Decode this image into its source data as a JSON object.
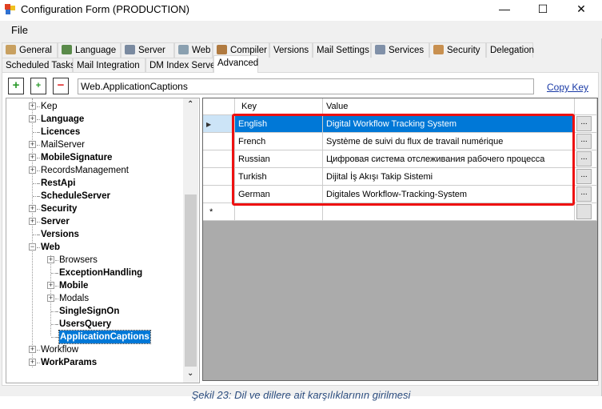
{
  "window": {
    "title": "Configuration Form (PRODUCTION)",
    "minimize": "—",
    "maximize": "☐",
    "close": "✕"
  },
  "menu": {
    "file": "File"
  },
  "tabs_row1": [
    {
      "label": "General",
      "icon": "gear-icon",
      "color": "#c8a060"
    },
    {
      "label": "Language",
      "icon": "globe-icon",
      "color": "#5a8a4a"
    },
    {
      "label": "Server",
      "icon": "server-icon",
      "color": "#7a8aa0"
    },
    {
      "label": "Web",
      "icon": "web-page-icon",
      "color": "#8aa0b0"
    },
    {
      "label": "Compiler",
      "icon": "compiler-icon",
      "color": "#b07a40"
    },
    {
      "label": "Versions"
    },
    {
      "label": "Mail Settings"
    },
    {
      "label": "Services",
      "icon": "cog-icon",
      "color": "#8090a8"
    },
    {
      "label": "Security",
      "icon": "keys-icon",
      "color": "#c89050"
    },
    {
      "label": "Delegation"
    }
  ],
  "tabs_row2": [
    {
      "label": "Scheduled Tasks"
    },
    {
      "label": "Mail Integration"
    },
    {
      "label": "DM Index Server"
    },
    {
      "label": "Advanced"
    }
  ],
  "toolbar": {
    "add_root": "+",
    "add_child": "+",
    "remove": "−",
    "key_value": "Web.ApplicationCaptions",
    "copy_key": "Copy Key"
  },
  "tree": [
    {
      "label": "Kep",
      "level": 1,
      "expandable": true,
      "bold": false
    },
    {
      "label": "Language",
      "level": 1,
      "expandable": true,
      "bold": true
    },
    {
      "label": "Licences",
      "level": 1,
      "expandable": false,
      "bold": true
    },
    {
      "label": "MailServer",
      "level": 1,
      "expandable": true,
      "bold": false
    },
    {
      "label": "MobileSignature",
      "level": 1,
      "expandable": true,
      "bold": true
    },
    {
      "label": "RecordsManagement",
      "level": 1,
      "expandable": true,
      "bold": false
    },
    {
      "label": "RestApi",
      "level": 1,
      "expandable": false,
      "bold": true
    },
    {
      "label": "ScheduleServer",
      "level": 1,
      "expandable": false,
      "bold": true
    },
    {
      "label": "Security",
      "level": 1,
      "expandable": true,
      "bold": true
    },
    {
      "label": "Server",
      "level": 1,
      "expandable": true,
      "bold": true
    },
    {
      "label": "Versions",
      "level": 1,
      "expandable": false,
      "bold": true
    },
    {
      "label": "Web",
      "level": 1,
      "expandable": true,
      "expanded": true,
      "bold": true
    },
    {
      "label": "Browsers",
      "level": 2,
      "expandable": true,
      "bold": false
    },
    {
      "label": "ExceptionHandling",
      "level": 2,
      "expandable": false,
      "bold": true
    },
    {
      "label": "Mobile",
      "level": 2,
      "expandable": true,
      "bold": true
    },
    {
      "label": "Modals",
      "level": 2,
      "expandable": true,
      "bold": false
    },
    {
      "label": "SingleSignOn",
      "level": 2,
      "expandable": false,
      "bold": true
    },
    {
      "label": "UsersQuery",
      "level": 2,
      "expandable": false,
      "bold": true
    },
    {
      "label": "ApplicationCaptions",
      "level": 2,
      "expandable": false,
      "bold": true,
      "selected": true
    },
    {
      "label": "Workflow",
      "level": 1,
      "expandable": true,
      "bold": false
    },
    {
      "label": "WorkParams",
      "level": 1,
      "expandable": true,
      "bold": true
    }
  ],
  "grid": {
    "columns": [
      "Key",
      "Value"
    ],
    "rows": [
      {
        "key": "English",
        "value": "Digital Workflow Tracking System",
        "selected": true
      },
      {
        "key": "French",
        "value": "Système de suivi du flux de travail numérique"
      },
      {
        "key": "Russian",
        "value": "Цифровая система отслеживания рабочего процесса"
      },
      {
        "key": "Turkish",
        "value": "Dijital İş Akışı Takip Sistemi"
      },
      {
        "key": "German",
        "value": "Digitales Workflow-Tracking-System"
      }
    ],
    "ellipsis": "...",
    "current_row_marker": "▶",
    "new_row_marker": "*"
  },
  "caption": "Şekil 23: Dil ve dillere ait karşılıklarının girilmesi"
}
